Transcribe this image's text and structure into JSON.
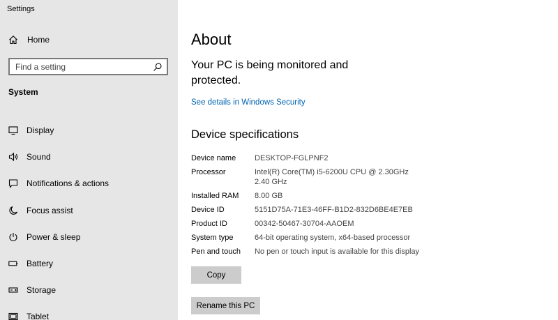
{
  "window": {
    "title": "Settings"
  },
  "sidebar": {
    "home_label": "Home",
    "search": {
      "placeholder": "Find a setting"
    },
    "section_label": "System",
    "items": [
      {
        "label": "Display",
        "icon": "monitor-icon"
      },
      {
        "label": "Sound",
        "icon": "speaker-icon"
      },
      {
        "label": "Notifications & actions",
        "icon": "notification-icon"
      },
      {
        "label": "Focus assist",
        "icon": "moon-icon"
      },
      {
        "label": "Power & sleep",
        "icon": "power-icon"
      },
      {
        "label": "Battery",
        "icon": "battery-icon"
      },
      {
        "label": "Storage",
        "icon": "storage-icon"
      },
      {
        "label": "Tablet",
        "icon": "tablet-icon"
      }
    ]
  },
  "main": {
    "title": "About",
    "protection_status": "Your PC is being monitored and protected.",
    "security_link": "See details in Windows Security",
    "specs_title": "Device specifications",
    "specs": [
      {
        "key": "Device name",
        "value": "DESKTOP-FGLPNF2"
      },
      {
        "key": "Processor",
        "value": "Intel(R) Core(TM) i5-6200U CPU @ 2.30GHz   2.40 GHz"
      },
      {
        "key": "Installed RAM",
        "value": "8.00 GB"
      },
      {
        "key": "Device ID",
        "value": "5151D75A-71E3-46FF-B1D2-832D6BE4E7EB"
      },
      {
        "key": "Product ID",
        "value": "00342-50467-30704-AAOEM"
      },
      {
        "key": "System type",
        "value": "64-bit operating system, x64-based processor"
      },
      {
        "key": "Pen and touch",
        "value": "No pen or touch input is available for this display"
      }
    ],
    "copy_label": "Copy",
    "rename_label": "Rename this PC"
  }
}
